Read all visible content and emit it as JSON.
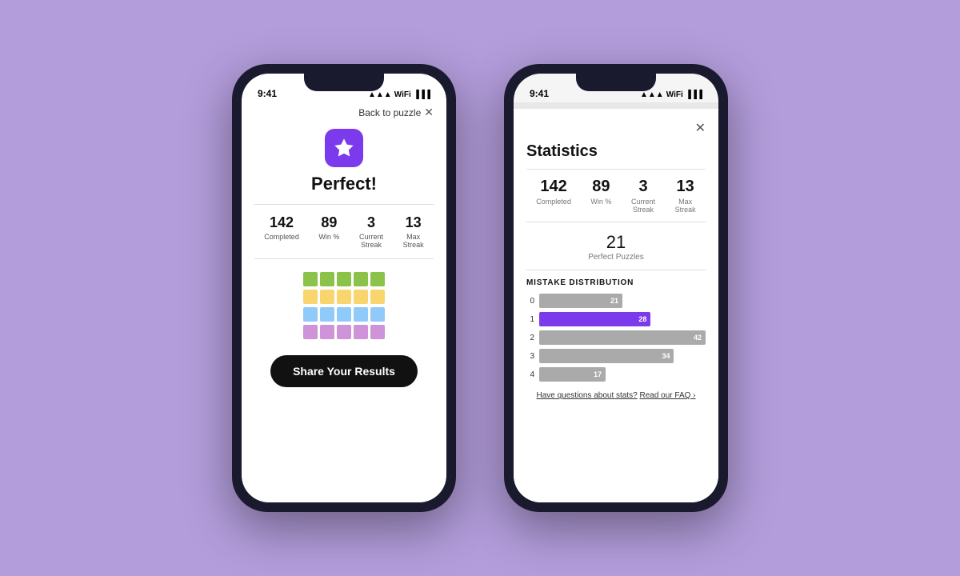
{
  "phone1": {
    "status_time": "9:41",
    "status_icons": "▲▲▲ ● ●●",
    "back_link": "Back to puzzle",
    "close_x": "✕",
    "title": "Perfect!",
    "stats": [
      {
        "num": "142",
        "label": "Completed"
      },
      {
        "num": "89",
        "label": "Win %"
      },
      {
        "num": "3",
        "label": "Current\nStreak"
      },
      {
        "num": "13",
        "label": "Max\nStreak"
      }
    ],
    "tiles": [
      [
        "green",
        "green",
        "green",
        "green",
        "green"
      ],
      [
        "yellow",
        "yellow",
        "yellow",
        "yellow",
        "yellow"
      ],
      [
        "blue",
        "blue",
        "blue",
        "blue",
        "blue"
      ],
      [
        "purple",
        "purple",
        "purple",
        "purple",
        "purple"
      ]
    ],
    "share_btn": "Share Your Results"
  },
  "phone2": {
    "status_time": "9:41",
    "title": "Statistics",
    "close_x": "✕",
    "stats": [
      {
        "num": "142",
        "label": "Completed"
      },
      {
        "num": "89",
        "label": "Win %"
      },
      {
        "num": "3",
        "label": "Current\nStreak"
      },
      {
        "num": "13",
        "label": "Max\nStreak"
      }
    ],
    "perfect_num": "21",
    "perfect_label": "Perfect Puzzles",
    "mistake_title": "MISTAKE DISTRIBUTION",
    "bars": [
      {
        "label": "0",
        "value": 21,
        "max": 42,
        "type": "gray"
      },
      {
        "label": "1",
        "value": 28,
        "max": 42,
        "type": "purple"
      },
      {
        "label": "2",
        "value": 42,
        "max": 42,
        "type": "gray"
      },
      {
        "label": "3",
        "value": 34,
        "max": 42,
        "type": "gray"
      },
      {
        "label": "4",
        "value": 17,
        "max": 42,
        "type": "gray"
      }
    ],
    "faq_text": "Have questions about stats?",
    "faq_link": "Read our FAQ ›"
  },
  "background": "#b39ddb"
}
